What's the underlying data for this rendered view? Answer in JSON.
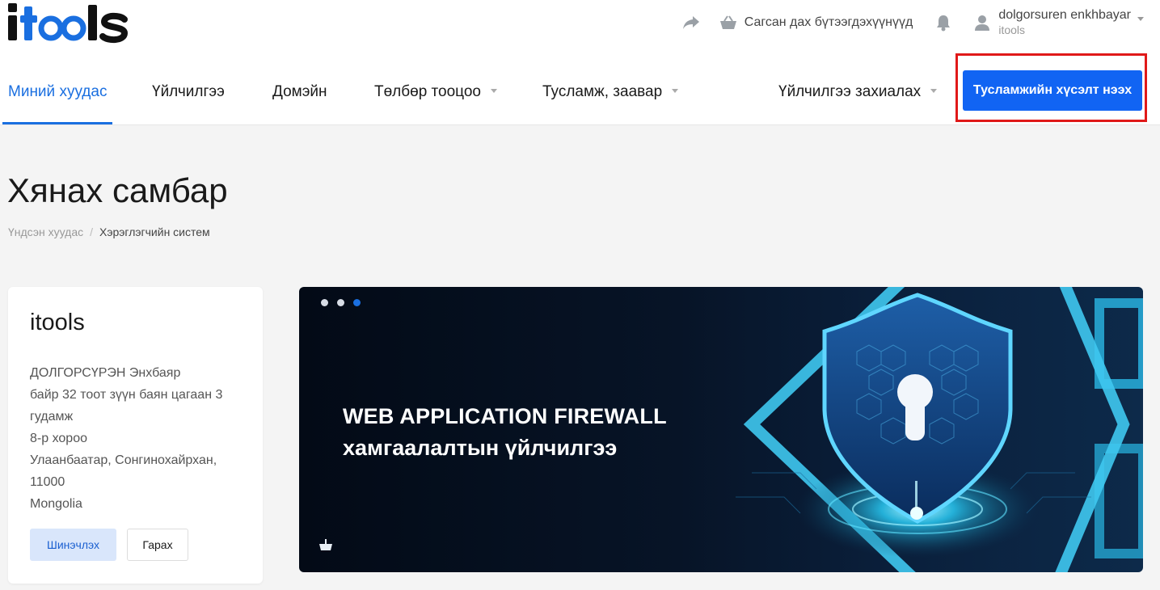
{
  "header": {
    "logo_text": "itools",
    "cart_label": "Сагсан дах бүтээгдэхүүнүүд",
    "user_name": "dolgorsuren enkhbayar",
    "user_org": "itools"
  },
  "nav": {
    "items": [
      {
        "label": "Миний хуудас",
        "active": true
      },
      {
        "label": "Үйлчилгээ"
      },
      {
        "label": "Домэйн"
      },
      {
        "label": "Төлбөр тооцоо"
      },
      {
        "label": "Тусламж, заавар"
      },
      {
        "label": "Үйлчилгээ захиалах"
      }
    ],
    "support_button": "Тусламжийн хүсэлт нээх"
  },
  "page": {
    "title": "Хянах самбар",
    "breadcrumb": {
      "home": "Үндсэн хуудас",
      "current": "Хэрэглэгчийн систем"
    }
  },
  "account_card": {
    "title": "itools",
    "lines": [
      "ДОЛГОРСҮРЭН Энхбаяр",
      "байр 32 тоот зүүн баян цагаан 3",
      "гудамж",
      "8-р хороо",
      "Улаанбаатар, Сонгинохайрхан,",
      "11000",
      "Mongolia"
    ],
    "edit_button": "Шинэчлэх",
    "logout_button": "Гарах"
  },
  "banner": {
    "line1": "WEB APPLICATION FIREWALL",
    "line2": "хамгаалалтын үйлчилгээ",
    "slides": 3,
    "active_slide": 3
  },
  "colors": {
    "accent": "#1a6fe0",
    "button": "#1164f3",
    "highlight": "#e01919"
  }
}
